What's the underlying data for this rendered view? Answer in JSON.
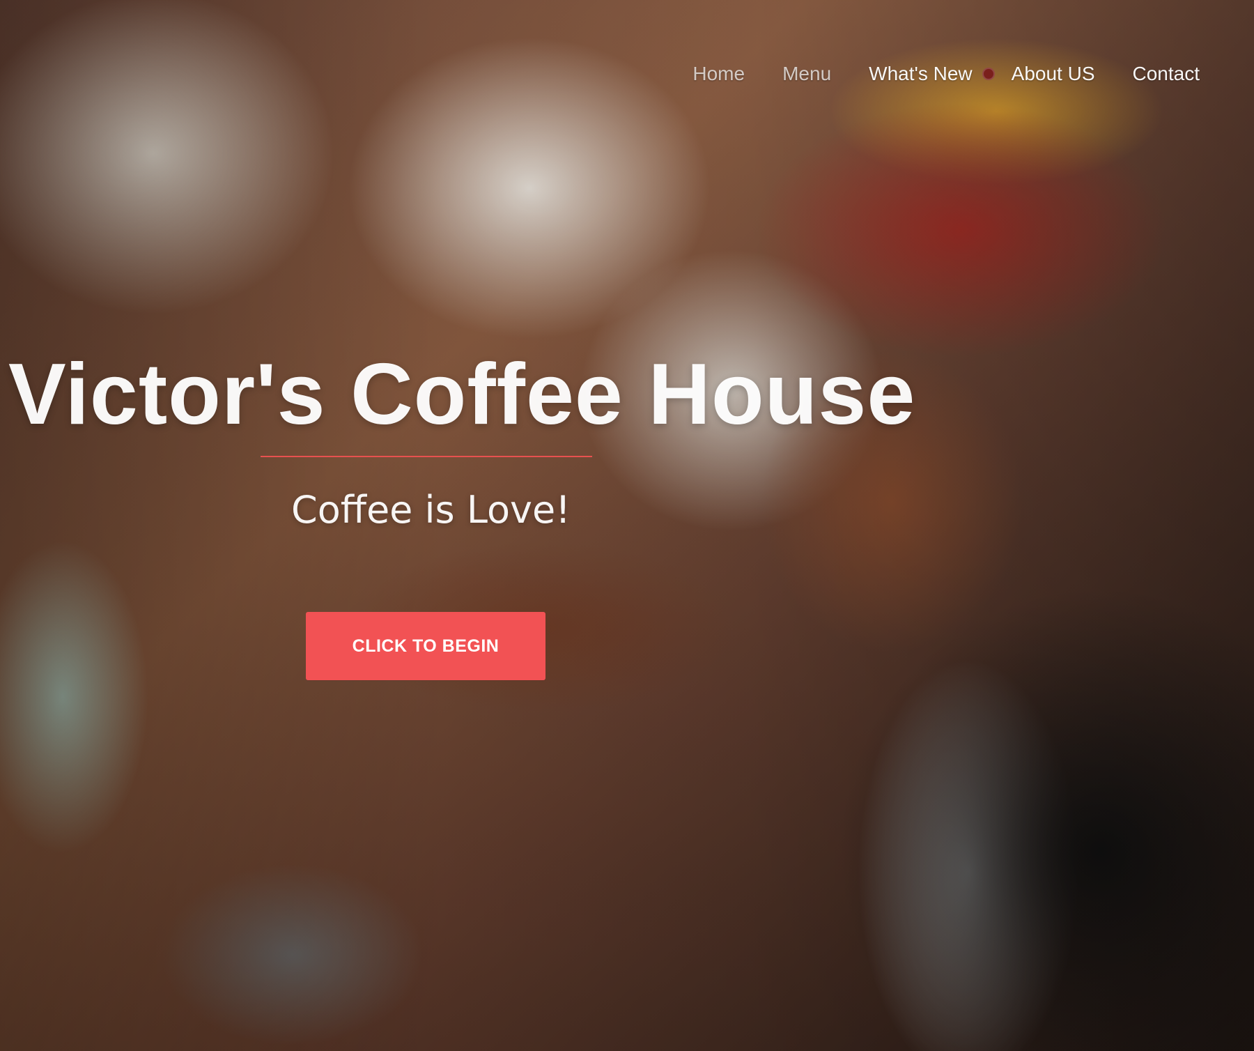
{
  "nav": {
    "items": [
      {
        "label": "Home"
      },
      {
        "label": "Menu"
      },
      {
        "label": "What's New"
      },
      {
        "label": "About US"
      },
      {
        "label": "Contact"
      }
    ]
  },
  "hero": {
    "title": "Victor's Coffee House",
    "subtitle": "Coffee is Love!",
    "cta_label": "CLICK TO BEGIN"
  },
  "colors": {
    "accent": "#f25254",
    "text": "#ffffff"
  }
}
